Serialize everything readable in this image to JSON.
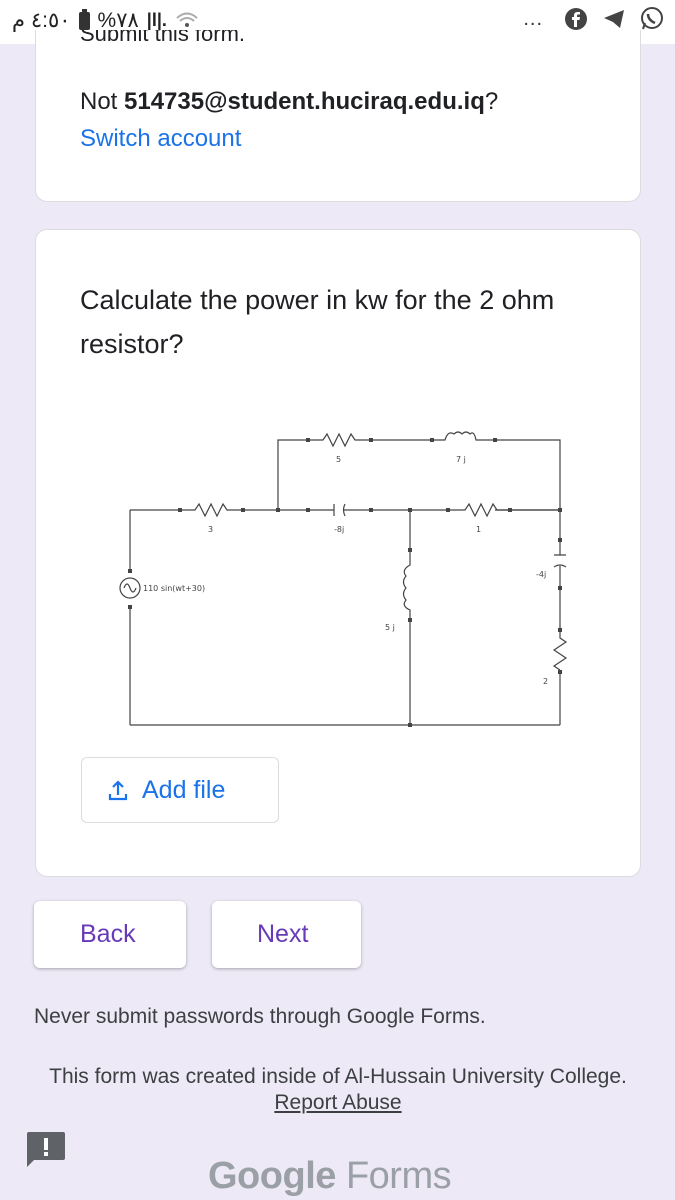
{
  "status_bar": {
    "time": "٤:٥٠ م",
    "battery": "%٧٨",
    "signal": "|l|.",
    "more": "...",
    "apps": [
      "facebook-icon",
      "telegram-icon",
      "whatsapp-icon"
    ]
  },
  "account_card": {
    "cut_text": "Submit this form.",
    "not_prefix": "Not ",
    "email": "514735@student.huciraq.edu.iq",
    "not_suffix": "?",
    "switch_account": "Switch account"
  },
  "question_card": {
    "question": "Calculate the power in kw for the 2 ohm resistor?",
    "circuit": {
      "source": "110 sin(wt+30)",
      "r3": "3",
      "r5": "5",
      "l7j": "7 j",
      "c8j": "-8j",
      "r1": "1",
      "l5j": "5 j",
      "c4j": "-4j",
      "r2": "2"
    },
    "add_file": "Add file"
  },
  "navigation": {
    "back": "Back",
    "next": "Next"
  },
  "footer": {
    "warning": "Never submit passwords through Google Forms.",
    "created": "This form was created inside of Al-Hussain University College.",
    "report_abuse": "Report Abuse",
    "brand_google": "Google",
    "brand_forms": "Forms"
  },
  "colors": {
    "background": "#ede9f6",
    "link_blue": "#1a73e8",
    "accent_purple": "#673ab7"
  }
}
